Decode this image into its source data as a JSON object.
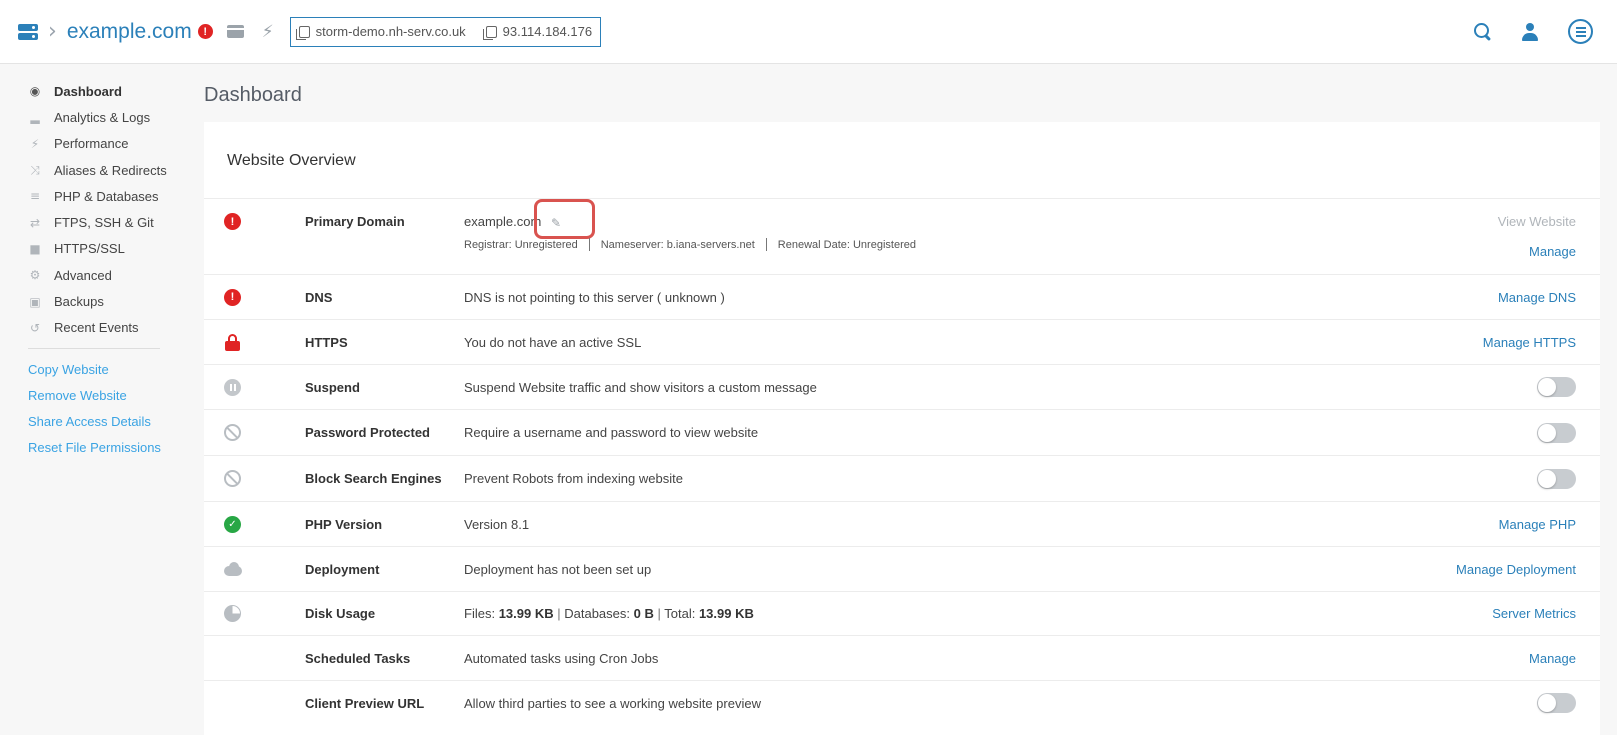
{
  "header": {
    "site_name": "example.com",
    "error_badge": "!",
    "hostname": "storm-demo.nh-serv.co.uk",
    "ip": "93.114.184.176"
  },
  "sidebar": {
    "items": [
      {
        "label": "Dashboard",
        "icon": "dashboard-icon"
      },
      {
        "label": "Analytics & Logs",
        "icon": "chart-icon"
      },
      {
        "label": "Performance",
        "icon": "bolt-icon"
      },
      {
        "label": "Aliases & Redirects",
        "icon": "shuffle-icon"
      },
      {
        "label": "PHP & Databases",
        "icon": "database-icon"
      },
      {
        "label": "FTPS, SSH & Git",
        "icon": "transfer-icon"
      },
      {
        "label": "HTTPS/SSL",
        "icon": "lock-icon"
      },
      {
        "label": "Advanced",
        "icon": "wrench-icon"
      },
      {
        "label": "Backups",
        "icon": "camera-icon"
      },
      {
        "label": "Recent Events",
        "icon": "history-icon"
      }
    ],
    "links": [
      "Copy Website",
      "Remove Website",
      "Share Access Details",
      "Reset File Permissions"
    ]
  },
  "main": {
    "page_title": "Dashboard",
    "panel_title": "Website Overview",
    "primary_domain": {
      "label": "Primary Domain",
      "value": "example.com",
      "registrar": "Registrar: Unregistered",
      "nameserver": "Nameserver: b.iana-servers.net",
      "renewal": "Renewal Date: Unregistered",
      "view": "View Website",
      "manage": "Manage"
    },
    "dns": {
      "label": "DNS",
      "desc": "DNS is not pointing to this server ( unknown )",
      "action": "Manage DNS"
    },
    "https": {
      "label": "HTTPS",
      "desc": "You do not have an active SSL",
      "action": "Manage HTTPS"
    },
    "suspend": {
      "label": "Suspend",
      "desc": "Suspend Website traffic and show visitors a custom message",
      "enabled": false
    },
    "password": {
      "label": "Password Protected",
      "desc": "Require a username and password to view website",
      "enabled": false
    },
    "block": {
      "label": "Block Search Engines",
      "desc": "Prevent Robots from indexing website",
      "enabled": false
    },
    "php": {
      "label": "PHP Version",
      "desc": "Version 8.1",
      "action": "Manage PHP"
    },
    "deploy": {
      "label": "Deployment",
      "desc": "Deployment has not been set up",
      "action": "Manage Deployment"
    },
    "disk": {
      "label": "Disk Usage",
      "files_label": "Files:",
      "files": "13.99 KB",
      "db_label": "Databases:",
      "db": "0 B",
      "total_label": "Total:",
      "total": "13.99 KB",
      "action": "Server Metrics"
    },
    "cron": {
      "label": "Scheduled Tasks",
      "desc": "Automated tasks using Cron Jobs",
      "action": "Manage"
    },
    "preview": {
      "label": "Client Preview URL",
      "desc": "Allow third parties to see a working website preview",
      "enabled": false
    }
  },
  "colors": {
    "accent": "#2b80b9",
    "link": "#3aa3e3",
    "error": "#e02424",
    "success": "#28a745",
    "highlight": "#d9534f"
  }
}
